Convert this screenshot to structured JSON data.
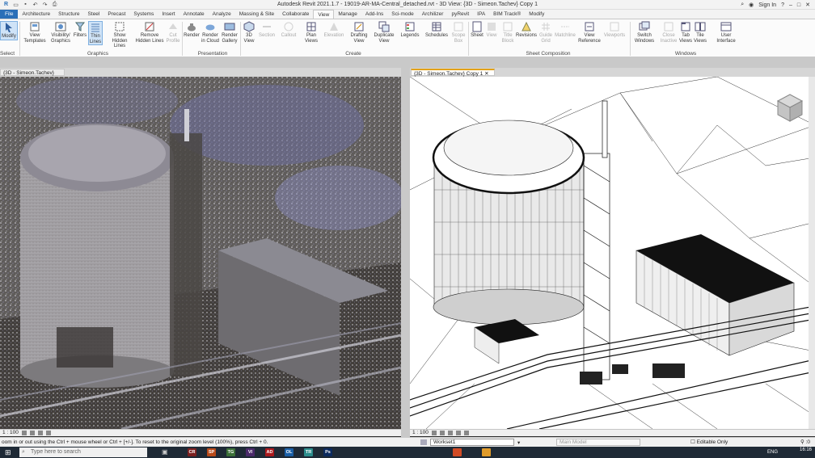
{
  "window": {
    "title": "Autodesk Revit 2021.1.7 - 19019-AR-MA-Central_detached.rvt - 3D View: {3D - Simeon.Tachev} Copy 1",
    "sign_in": "Sign In"
  },
  "tabs": [
    "File",
    "Architecture",
    "Structure",
    "Steel",
    "Precast",
    "Systems",
    "Insert",
    "Annotate",
    "Analyze",
    "Massing & Site",
    "Collaborate",
    "View",
    "Manage",
    "Add-Ins",
    "Sci-mode",
    "Archilizer",
    "pyRevit",
    "IPA",
    "BIM Track®",
    "Modify"
  ],
  "active_tab": "View",
  "ribbon": {
    "modify": "Modify",
    "select": "Select",
    "view_templates": "View Templates",
    "visibility_graphics": "Visibility/ Graphics",
    "filters": "Filters",
    "thin_lines": "Thin Lines",
    "show_hidden_lines": "Show Hidden Lines",
    "remove_hidden_lines": "Remove Hidden Lines",
    "cut_profile": "Cut Profile",
    "graphics_group": "Graphics",
    "render": "Render",
    "render_cloud": "Render in Cloud",
    "render_gallery": "Render Gallery",
    "presentation_group": "Presentation",
    "view_3d": "3D View",
    "section": "Section",
    "callout": "Callout",
    "plan_views": "Plan Views",
    "elevation": "Elevation",
    "drafting_view": "Drafting View",
    "duplicate_view": "Duplicate View",
    "legends": "Legends",
    "schedules": "Schedules",
    "scope_box": "Scope Box",
    "create_group": "Create",
    "sheet": "Sheet",
    "view": "View",
    "title_block": "Title Block",
    "revisions": "Revisions",
    "guide_grid": "Guide Grid",
    "matchline": "Matchline",
    "view_reference": "View Reference",
    "viewports": "Viewports",
    "sheet_comp_group": "Sheet Composition",
    "switch_windows": "Switch Windows",
    "close_inactive": "Close Inactive",
    "tab_views": "Tab Views",
    "tile_views": "Tile Views",
    "user_interface": "User Interface",
    "windows_group": "Windows"
  },
  "views": {
    "left_tab": "{3D - Simeon.Tachev}",
    "right_tab": "{3D - Simeon.Tachev} Copy 1",
    "left_scale": "1 : 100",
    "right_scale": "1 : 100"
  },
  "status": {
    "message": "oom in or out using the Ctrl + mouse wheel or Ctrl + [+/-]. To reset to the original zoom level (100%), press Ctrl + 0.",
    "workset": "Workset1",
    "main_model": "Main Model",
    "editable_only": "Editable Only"
  },
  "taskbar": {
    "search_placeholder": "Type here to search",
    "apps": [
      "CR",
      "SP",
      "TG",
      "VI",
      "AD",
      "OL",
      "TR",
      "Ps"
    ],
    "lang": "ENG",
    "time": "16:16"
  },
  "colors": {
    "file_tab": "#2a6fb8",
    "active_view_tab": "#e3a21a",
    "taskbar": "#1f2a36"
  }
}
